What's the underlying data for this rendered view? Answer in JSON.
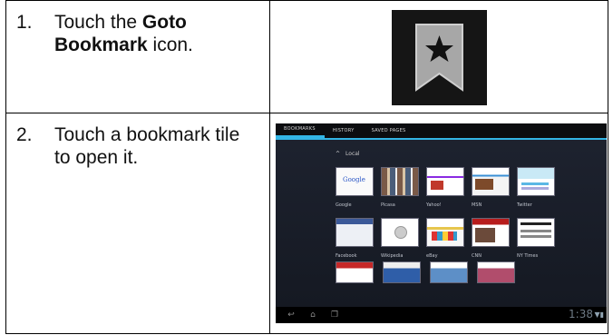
{
  "steps": [
    {
      "number": "1.",
      "prefix": "Touch the ",
      "bold": "Goto Bookmark",
      "suffix": " icon."
    },
    {
      "number": "2.",
      "text": "Touch a bookmark tile to open it."
    }
  ],
  "icon": {
    "name": "bookmark-star-icon"
  },
  "screenshot": {
    "tabs": [
      "BOOKMARKS",
      "HISTORY",
      "SAVED PAGES"
    ],
    "folder_label": "Local",
    "tile_labels_row1": [
      "Google",
      "Picasa",
      "Yahoo!",
      "MSN",
      "Twitter"
    ],
    "tile_labels_row2": [
      "Facebook",
      "Wikipedia",
      "eBay",
      "CNN",
      "NY Times"
    ],
    "google_logo_text": "Google",
    "clock": "1:38"
  }
}
